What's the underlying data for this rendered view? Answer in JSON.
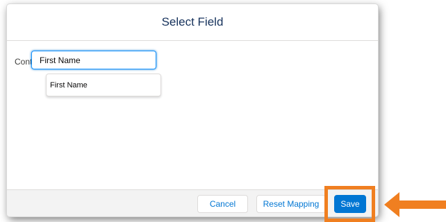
{
  "dialog": {
    "title": "Select Field"
  },
  "mapping": {
    "object_label": "Contact",
    "field_value": "First Name",
    "field_placeholder": "",
    "dropdown_options": [
      "First Name"
    ]
  },
  "footer": {
    "cancel_label": "Cancel",
    "reset_label": "Reset Mapping",
    "save_label": "Save"
  },
  "colors": {
    "brand": "#0176d3",
    "annotation": "#f07f20",
    "footer_bg": "#f3f3f3"
  },
  "icons": {
    "breadcrumb_caret": "caret-right-icon",
    "annotation_arrow": "arrow-left-icon"
  }
}
